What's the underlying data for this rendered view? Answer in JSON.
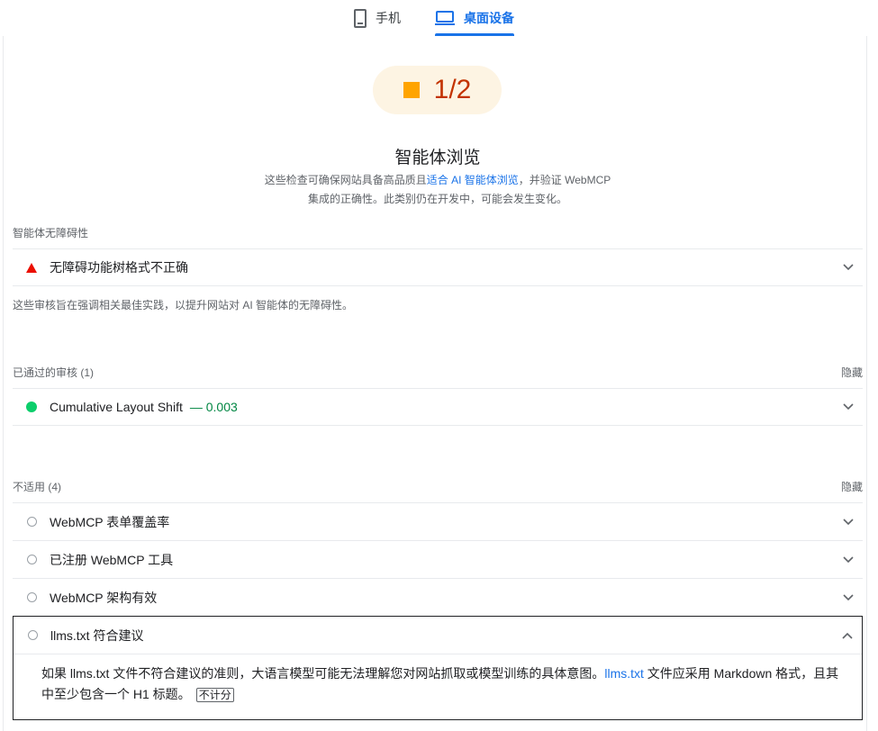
{
  "tabs": {
    "mobile_label": "手机",
    "desktop_label": "桌面设备"
  },
  "score": {
    "value": "1/2",
    "color": "#ffa400"
  },
  "category": {
    "title": "智能体浏览",
    "desc_part1": "这些检查可确保网站具备高品质且",
    "desc_link": "适合 AI 智能体浏览",
    "desc_part2": "，并验证 WebMCP",
    "desc_line2": "集成的正确性。此类别仍在开发中，可能会发生变化。"
  },
  "accessibility_group": {
    "heading": "智能体无障碍性",
    "audit_title": "无障碍功能树格式不正确",
    "description": "这些审核旨在强调相关最佳实践，以提升网站对 AI 智能体的无障碍性。"
  },
  "passed_group": {
    "heading": "已通过的审核",
    "count": "(1)",
    "toggle": "隐藏",
    "audits": [
      {
        "title": "Cumulative Layout Shift",
        "metric": "— 0.003"
      }
    ]
  },
  "na_group": {
    "heading": "不适用",
    "count": "(4)",
    "toggle": "隐藏",
    "audits": [
      {
        "title": "WebMCP 表单覆盖率"
      },
      {
        "title": "已注册 WebMCP 工具"
      },
      {
        "title": "WebMCP 架构有效"
      }
    ],
    "expanded": {
      "title": "llms.txt 符合建议",
      "body_part1": "如果 llms.txt 文件不符合建议的准则，大语言模型可能无法理解您对网站抓取或模型训练的具体意图。",
      "body_link": "llms.txt",
      "body_part2": " 文件应采用 Markdown 格式，且其中至少包含一个 H1 标题。",
      "unscored_label": "不计分"
    }
  },
  "colors": {
    "accent": "#1a73e8",
    "fail": "#eb0f00",
    "pass": "#0cce6b",
    "average": "#ffa400"
  }
}
